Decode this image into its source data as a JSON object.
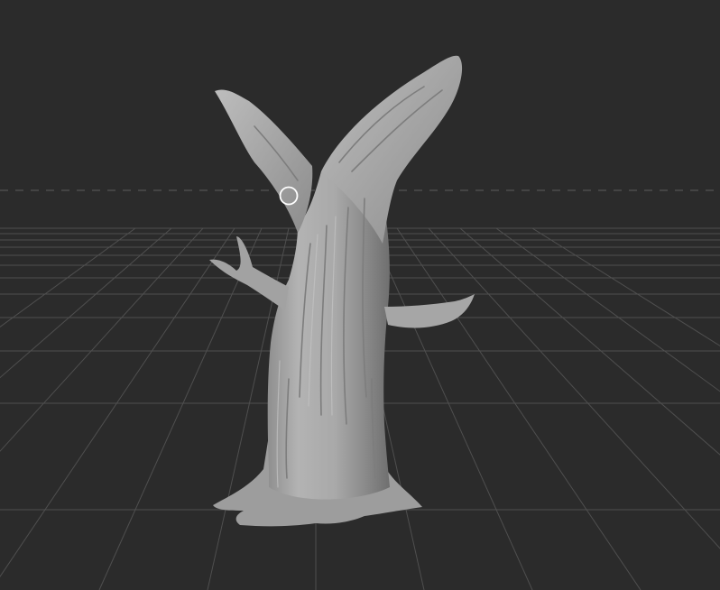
{
  "app": {
    "view": "3d-sculpt-viewport",
    "background_color": "#2b2b2b"
  },
  "scene": {
    "model": "dead-tree-trunk",
    "material_color": "#a8a8a8",
    "grid": {
      "visible": true,
      "line_color": "#555555",
      "horizon_dashed": true
    },
    "cursor": {
      "shape": "brush-circle",
      "color": "#ffffff"
    }
  }
}
